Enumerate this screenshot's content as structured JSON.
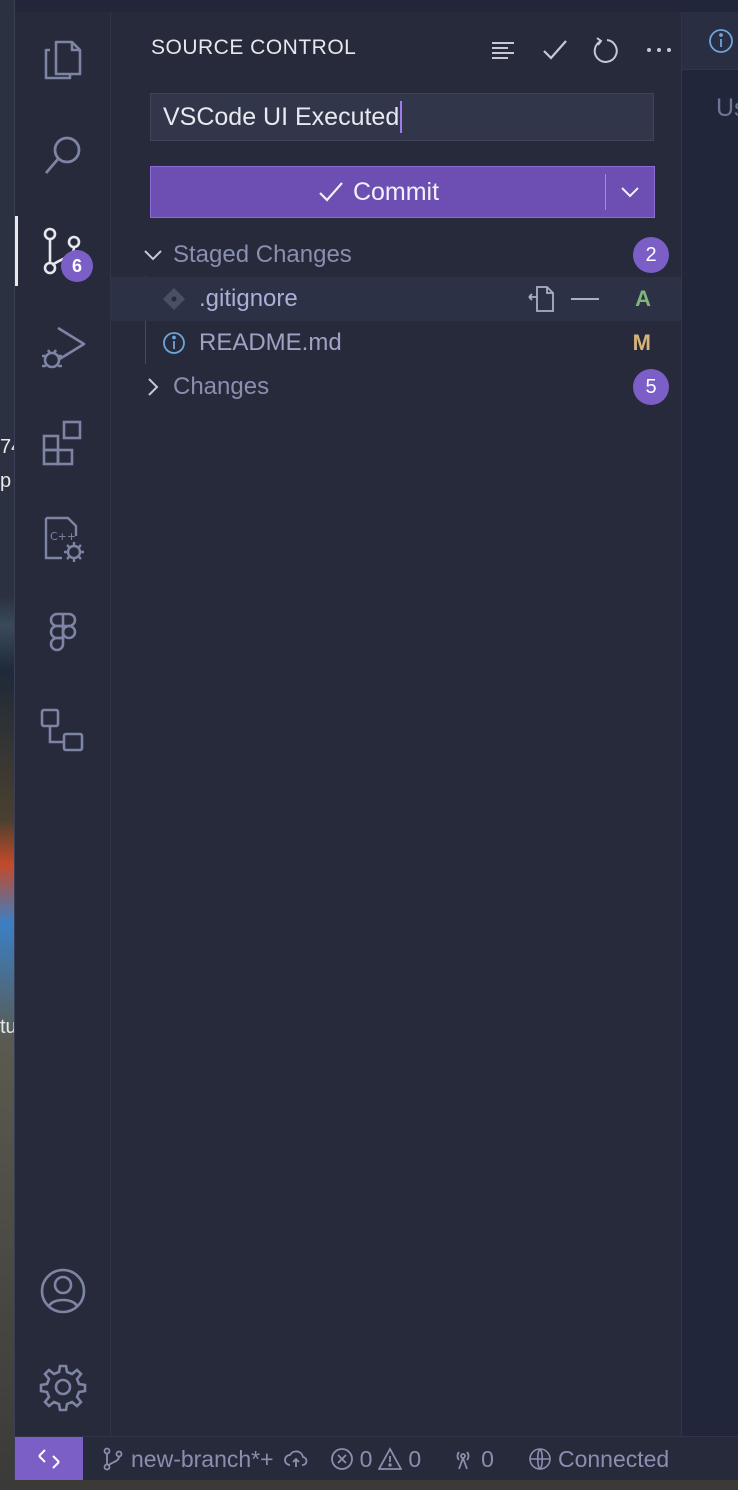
{
  "desktop": {
    "fragments": [
      "74",
      "p",
      "tu"
    ]
  },
  "sidebar": {
    "title": "SOURCE CONTROL",
    "commit_message": "VSCode UI Executed",
    "commit_button_label": "Commit",
    "groups": [
      {
        "label": "Staged Changes",
        "count": "2",
        "expanded": true,
        "files": [
          {
            "name": ".gitignore",
            "status": "A",
            "status_color": "#7fb57a",
            "icon": "git-icon"
          },
          {
            "name": "README.md",
            "status": "M",
            "status_color": "#d6b37a",
            "icon": "info-icon"
          }
        ]
      },
      {
        "label": "Changes",
        "count": "5",
        "expanded": false
      }
    ]
  },
  "activity_bar": {
    "scm_badge": "6",
    "items": [
      "explorer-icon",
      "search-icon",
      "source-control-icon",
      "run-debug-icon",
      "extensions-icon",
      "cpp-settings-icon",
      "figma-icon",
      "remote-explorer-icon"
    ],
    "bottom": [
      "accounts-icon",
      "manage-gear-icon"
    ]
  },
  "editor": {
    "tab_icon": "info-icon",
    "text_fragment": "Us"
  },
  "statusbar": {
    "branch": "new-branch*+",
    "errors": "0",
    "warnings": "0",
    "ports": "0",
    "connection": "Connected"
  },
  "colors": {
    "accent": "#7b5fc7",
    "background": "#262a3b"
  }
}
